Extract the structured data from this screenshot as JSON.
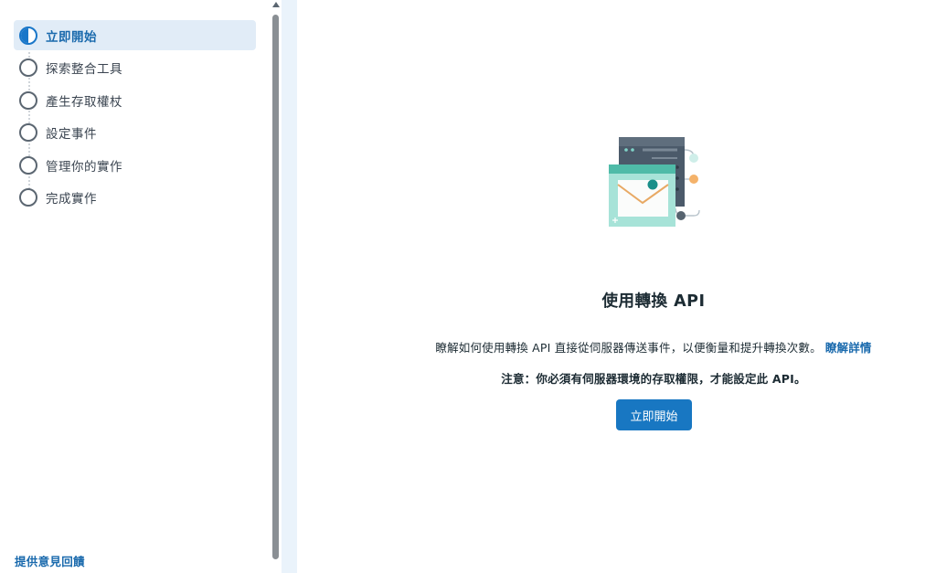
{
  "sidebar": {
    "steps": [
      {
        "label": "立即開始",
        "state": "in-progress"
      },
      {
        "label": "探索整合工具",
        "state": "pending"
      },
      {
        "label": "產生存取權杖",
        "state": "pending"
      },
      {
        "label": "設定事件",
        "state": "pending"
      },
      {
        "label": "管理你的實作",
        "state": "pending"
      },
      {
        "label": "完成實作",
        "state": "pending"
      }
    ],
    "feedback_label": "提供意見回饋"
  },
  "main": {
    "illustration_icon": "server-envelope-illustration",
    "title": "使用轉換 API",
    "description": "瞭解如何使用轉換 API 直接從伺服器傳送事件，以便衡量和提升轉換次數。",
    "learn_more_label": "瞭解詳情",
    "note": "注意：你必須有伺服器環境的存取權限，才能設定此 API。",
    "start_button_label": "立即開始"
  },
  "colors": {
    "accent": "#1877c2",
    "active_step_bg": "#e1ecf7",
    "link": "#1a6aad"
  }
}
